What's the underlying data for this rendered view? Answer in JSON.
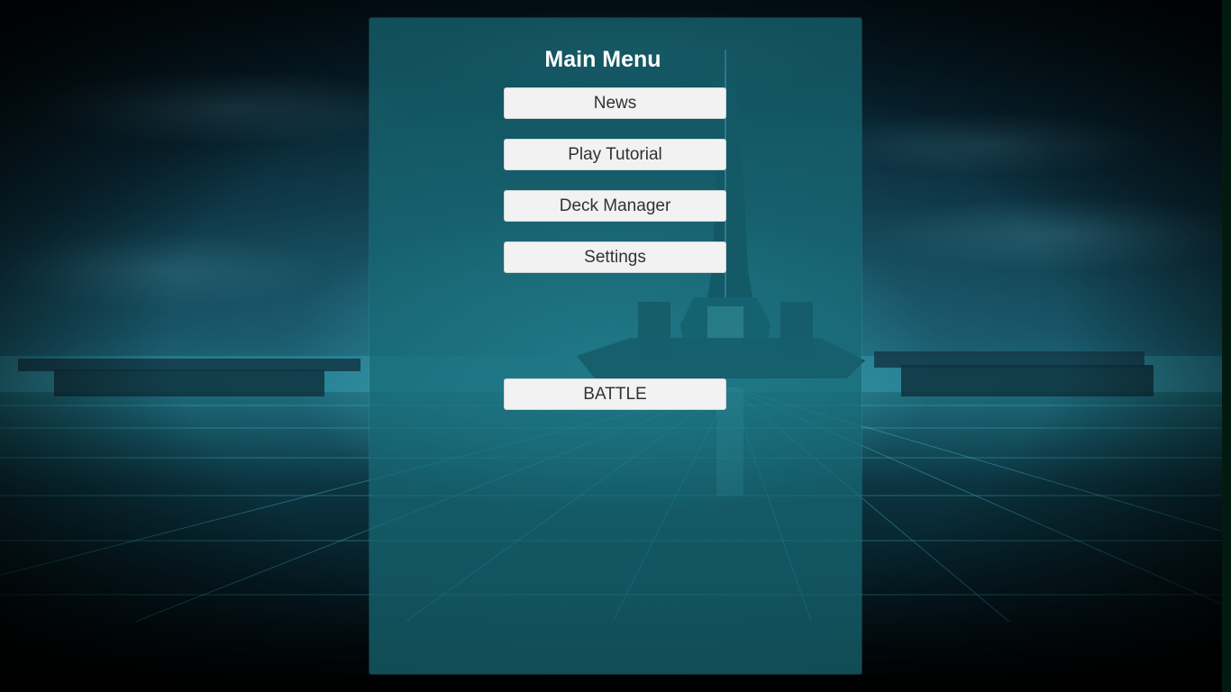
{
  "menu": {
    "title": "Main Menu",
    "buttons": {
      "news": "News",
      "play_tutorial": "Play Tutorial",
      "deck_manager": "Deck Manager",
      "settings": "Settings",
      "battle": "BATTLE"
    }
  },
  "colors": {
    "panel": "#18697680",
    "button_bg": "#f2f2f2",
    "button_text": "#323232",
    "title_text": "#ffffff"
  }
}
